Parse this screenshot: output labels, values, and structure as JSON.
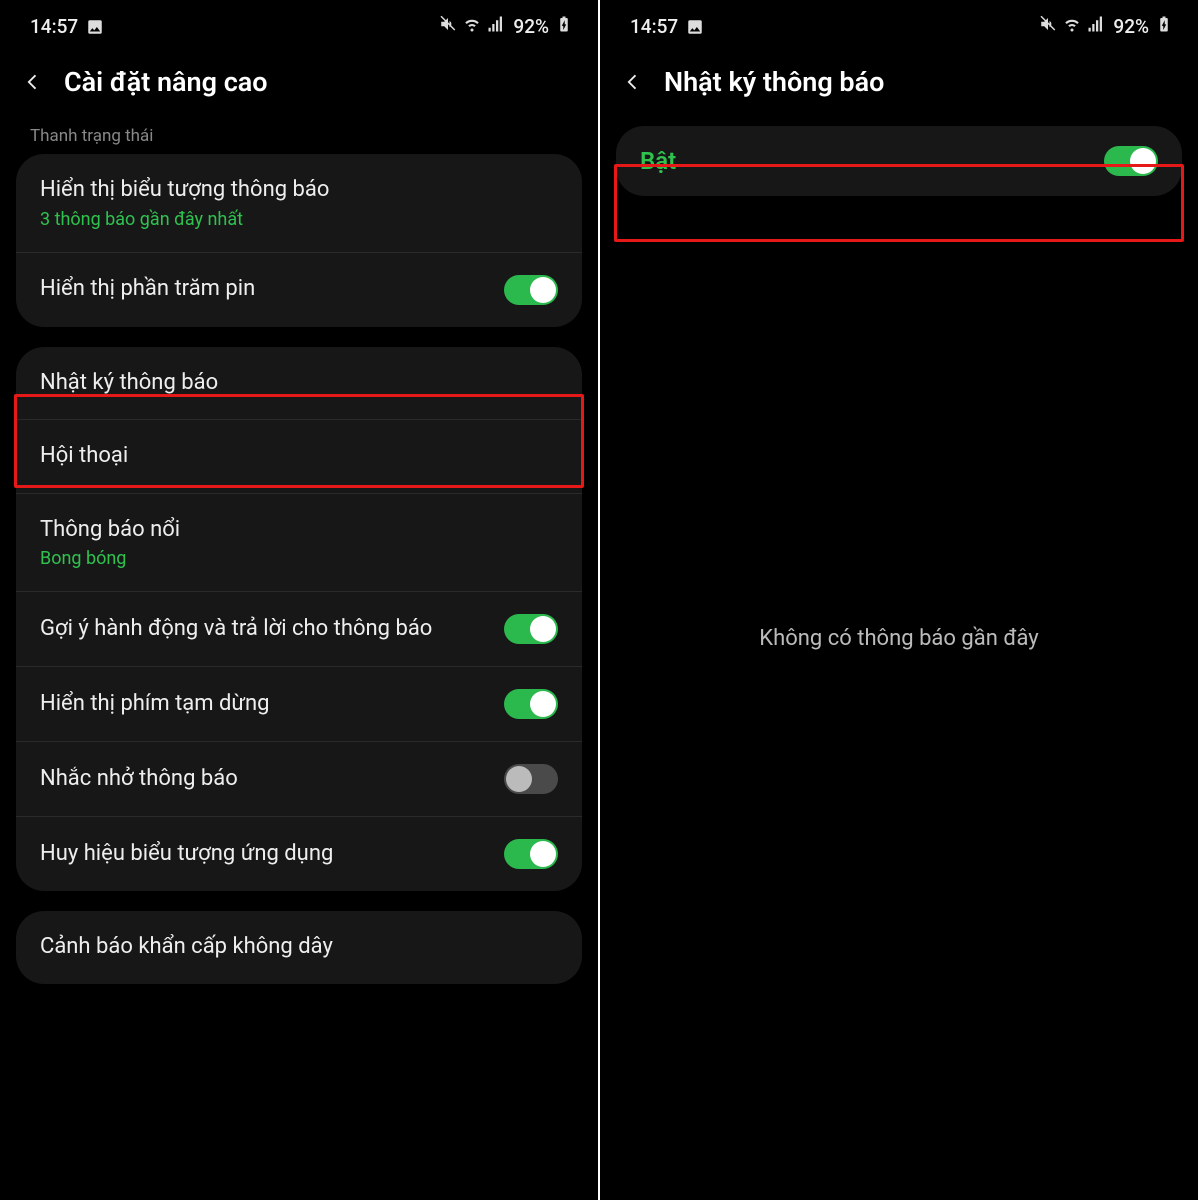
{
  "statusbar": {
    "time": "14:57",
    "battery_pct": "92%"
  },
  "screen1": {
    "title": "Cài đặt nâng cao",
    "section_label": "Thanh trạng thái",
    "rows": {
      "show_notif_icon": {
        "title": "Hiển thị biểu tượng thông báo",
        "sub": "3 thông báo gần đây nhất"
      },
      "battery_pct": {
        "title": "Hiển thị phần trăm pin"
      },
      "notif_history": {
        "title": "Nhật ký thông báo"
      },
      "conversations": {
        "title": "Hội thoại"
      },
      "floating": {
        "title": "Thông báo nổi",
        "sub": "Bong bóng"
      },
      "suggest": {
        "title": "Gợi ý hành động và trả lời cho thông báo"
      },
      "snooze": {
        "title": "Hiển thị phím tạm dừng"
      },
      "reminder": {
        "title": "Nhắc nhở thông báo"
      },
      "badges": {
        "title": "Huy hiệu biểu tượng ứng dụng"
      },
      "emergency": {
        "title": "Cảnh báo khẩn cấp không dây"
      }
    }
  },
  "screen2": {
    "title": "Nhật ký thông báo",
    "on_label": "Bật",
    "empty_msg": "Không có thông báo gần đây"
  }
}
